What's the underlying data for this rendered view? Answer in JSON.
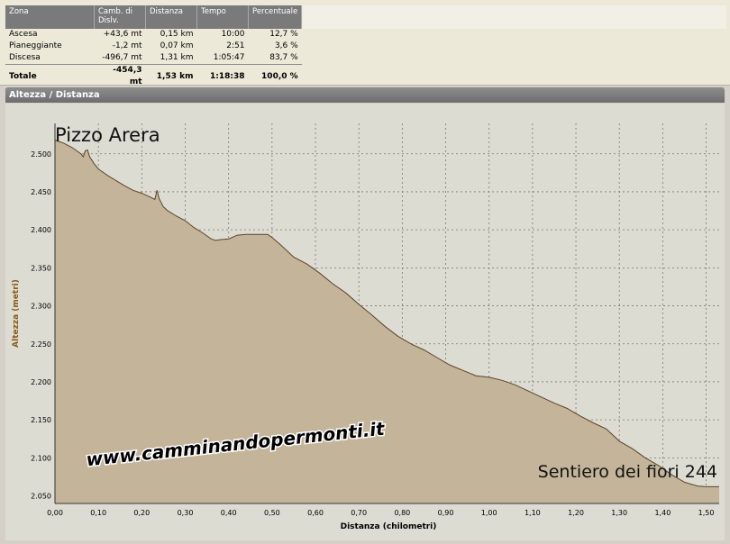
{
  "summary": {
    "headers": [
      "Zona",
      "Camb. di Dislv.",
      "Distanza",
      "Tempo",
      "Percentuale"
    ],
    "rows": [
      [
        "Ascesa",
        "+43,6 mt",
        "0,15 km",
        "10:00",
        "12,7 %"
      ],
      [
        "Pianeggiante",
        "-1,2 mt",
        "0,07 km",
        "2:51",
        "3,6 %"
      ],
      [
        "Discesa",
        "-496,7 mt",
        "1,31 km",
        "1:05:47",
        "83,7 %"
      ],
      [
        "Totale",
        "-454,3 mt",
        "1,53 km",
        "1:18:38",
        "100,0 %"
      ]
    ]
  },
  "panel": {
    "title": "Altezza / Distanza"
  },
  "overlays": {
    "start_label": "Pizzo Arera",
    "end_label": "Sentiero dei fiori 244",
    "watermark": "www.camminandopermonti.it"
  },
  "chart_data": {
    "type": "area",
    "xlabel": "Distanza (chilometri)",
    "ylabel": "Altezza (metri)",
    "xlim": [
      0,
      1.53
    ],
    "ylim": [
      2040,
      2540
    ],
    "x_ticks": [
      "0,00",
      "0,10",
      "0,20",
      "0,30",
      "0,40",
      "0,50",
      "0,60",
      "0,70",
      "0,80",
      "0,90",
      "1,00",
      "1,10",
      "1,20",
      "1,30",
      "1,40",
      "1,50"
    ],
    "y_ticks": [
      "2.050",
      "2.100",
      "2.150",
      "2.200",
      "2.250",
      "2.300",
      "2.350",
      "2.400",
      "2.450",
      "2.500"
    ],
    "grid": true,
    "colors": {
      "fill": "#c4b49a",
      "line": "#5a4528"
    },
    "x": [
      0.0,
      0.02,
      0.04,
      0.06,
      0.065,
      0.07,
      0.075,
      0.08,
      0.09,
      0.1,
      0.12,
      0.14,
      0.16,
      0.18,
      0.2,
      0.22,
      0.23,
      0.235,
      0.24,
      0.25,
      0.26,
      0.28,
      0.3,
      0.32,
      0.34,
      0.36,
      0.37,
      0.38,
      0.4,
      0.42,
      0.44,
      0.46,
      0.48,
      0.49,
      0.5,
      0.52,
      0.55,
      0.58,
      0.61,
      0.64,
      0.67,
      0.7,
      0.73,
      0.76,
      0.79,
      0.82,
      0.85,
      0.88,
      0.91,
      0.94,
      0.97,
      1.0,
      1.03,
      1.06,
      1.09,
      1.12,
      1.15,
      1.18,
      1.21,
      1.24,
      1.27,
      1.3,
      1.33,
      1.36,
      1.39,
      1.42,
      1.45,
      1.48,
      1.5,
      1.53
    ],
    "y": [
      2518,
      2514,
      2508,
      2500,
      2496,
      2504,
      2505,
      2496,
      2487,
      2480,
      2472,
      2465,
      2458,
      2452,
      2448,
      2443,
      2440,
      2452,
      2441,
      2430,
      2425,
      2418,
      2412,
      2403,
      2396,
      2388,
      2386,
      2387,
      2388,
      2393,
      2394,
      2394,
      2394,
      2394,
      2390,
      2380,
      2364,
      2355,
      2343,
      2329,
      2317,
      2302,
      2288,
      2273,
      2260,
      2250,
      2242,
      2232,
      2222,
      2215,
      2208,
      2206,
      2202,
      2196,
      2188,
      2180,
      2172,
      2165,
      2155,
      2146,
      2138,
      2122,
      2112,
      2100,
      2090,
      2078,
      2068,
      2063,
      2062,
      2062
    ]
  }
}
